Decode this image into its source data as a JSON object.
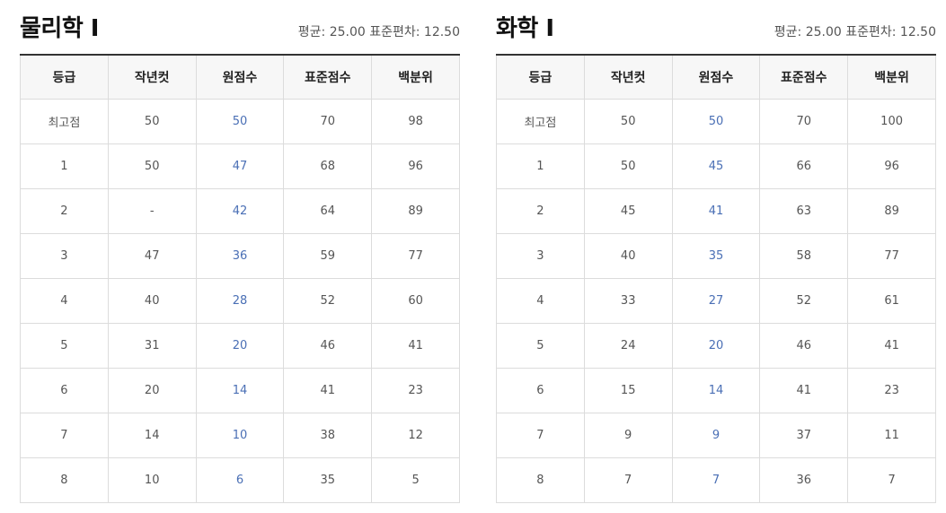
{
  "headers": [
    "등급",
    "작년컷",
    "원점수",
    "표준점수",
    "백분위"
  ],
  "subjects": [
    {
      "title": "물리학 Ⅰ",
      "stats": "평균: 25.00 표준편차: 12.50",
      "rows": [
        [
          "최고점",
          "50",
          "50",
          "70",
          "98"
        ],
        [
          "1",
          "50",
          "47",
          "68",
          "96"
        ],
        [
          "2",
          "-",
          "42",
          "64",
          "89"
        ],
        [
          "3",
          "47",
          "36",
          "59",
          "77"
        ],
        [
          "4",
          "40",
          "28",
          "52",
          "60"
        ],
        [
          "5",
          "31",
          "20",
          "46",
          "41"
        ],
        [
          "6",
          "20",
          "14",
          "41",
          "23"
        ],
        [
          "7",
          "14",
          "10",
          "38",
          "12"
        ],
        [
          "8",
          "10",
          "6",
          "35",
          "5"
        ]
      ]
    },
    {
      "title": "화학 Ⅰ",
      "stats": "평균: 25.00 표준편차: 12.50",
      "rows": [
        [
          "최고점",
          "50",
          "50",
          "70",
          "100"
        ],
        [
          "1",
          "50",
          "45",
          "66",
          "96"
        ],
        [
          "2",
          "45",
          "41",
          "63",
          "89"
        ],
        [
          "3",
          "40",
          "35",
          "58",
          "77"
        ],
        [
          "4",
          "33",
          "27",
          "52",
          "61"
        ],
        [
          "5",
          "24",
          "20",
          "46",
          "41"
        ],
        [
          "6",
          "15",
          "14",
          "41",
          "23"
        ],
        [
          "7",
          "9",
          "9",
          "37",
          "11"
        ],
        [
          "8",
          "7",
          "7",
          "36",
          "7"
        ]
      ]
    }
  ]
}
